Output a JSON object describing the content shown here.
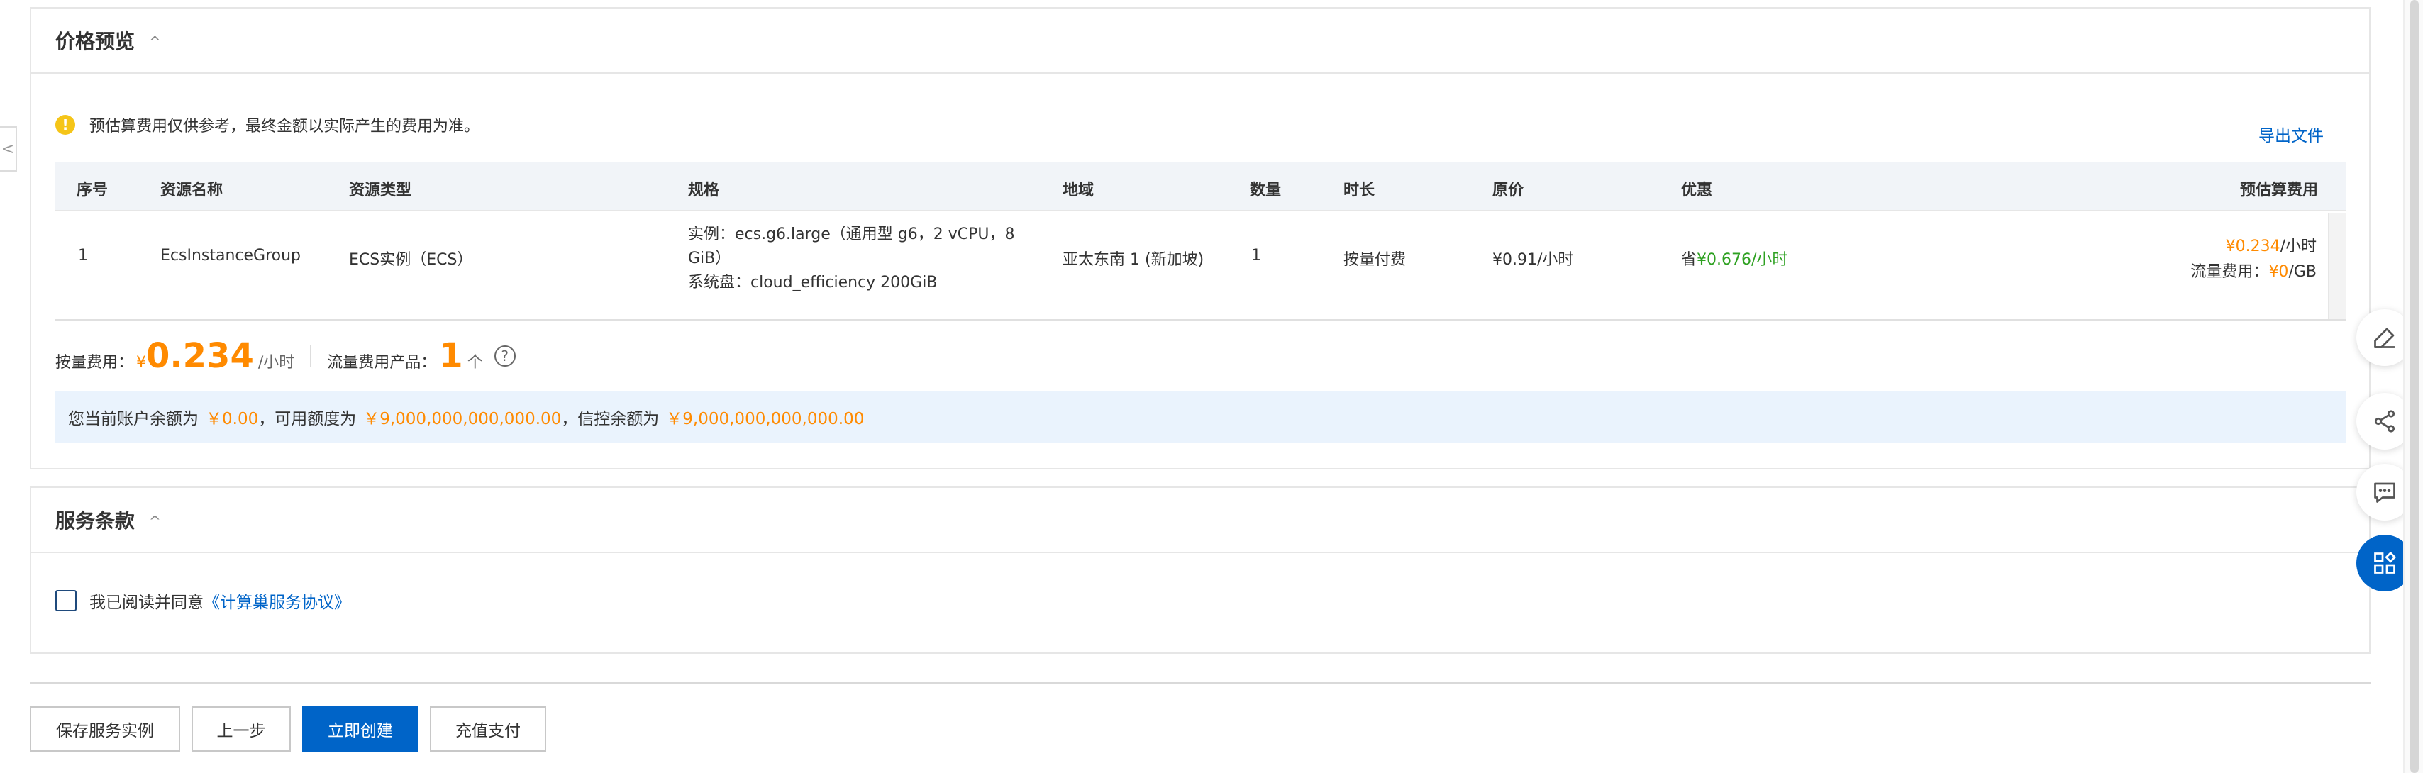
{
  "price_preview": {
    "title": "价格预览",
    "notice": "预估算费用仅供参考，最终金额以实际产生的费用为准。",
    "export_label": "导出文件",
    "columns": [
      "序号",
      "资源名称",
      "资源类型",
      "规格",
      "地域",
      "数量",
      "时长",
      "原价",
      "优惠",
      "预估算费用"
    ],
    "row": {
      "index": "1",
      "name": "EcsInstanceGroup",
      "type": "ECS实例（ECS）",
      "spec_line1": "实例：ecs.g6.large（通用型 g6，2 vCPU，8",
      "spec_line2": "GiB）",
      "spec_line3": "系统盘：cloud_efficiency 200GiB",
      "region": "亚太东南 1 (新加坡)",
      "quantity": "1",
      "duration": "按量付费",
      "original_price": "¥0.91/小时",
      "discount_prefix": "省",
      "discount_value": "¥0.676/小时",
      "estimate_value": "¥0.234",
      "estimate_unit": "/小时",
      "traffic_label": "流量费用：",
      "traffic_value": "¥0",
      "traffic_unit": "/GB"
    },
    "summary": {
      "pay_label": "按量费用：",
      "currency": "¥",
      "amount": "0.234",
      "unit": "/小时",
      "traffic_label": "流量费用产品：",
      "traffic_count": "1",
      "traffic_unit": "个",
      "help_glyph": "?"
    },
    "balance": {
      "prefix": "您当前账户余额为",
      "balance_value": "￥0.00",
      "mid1": "，可用额度为",
      "available_value": "￥9,000,000,000,000.00",
      "mid2": "，信控余额为",
      "credit_value": "￥9,000,000,000,000.00"
    }
  },
  "service_terms": {
    "title": "服务条款",
    "agree_text": "我已阅读并同意",
    "agree_link": "《计算巢服务协议》",
    "checked": false
  },
  "footer": {
    "save_label": "保存服务实例",
    "prev_label": "上一步",
    "create_label": "立即创建",
    "recharge_label": "充值支付"
  },
  "icons": {
    "collapse_caret": "^",
    "side_collapse": "<",
    "warn": "!"
  },
  "colors": {
    "primary": "#0064c8",
    "price_orange": "#ff8a00",
    "discount_green": "#2ea121",
    "notice_yellow": "#f5c518",
    "balance_bg": "#eaf3fd"
  }
}
